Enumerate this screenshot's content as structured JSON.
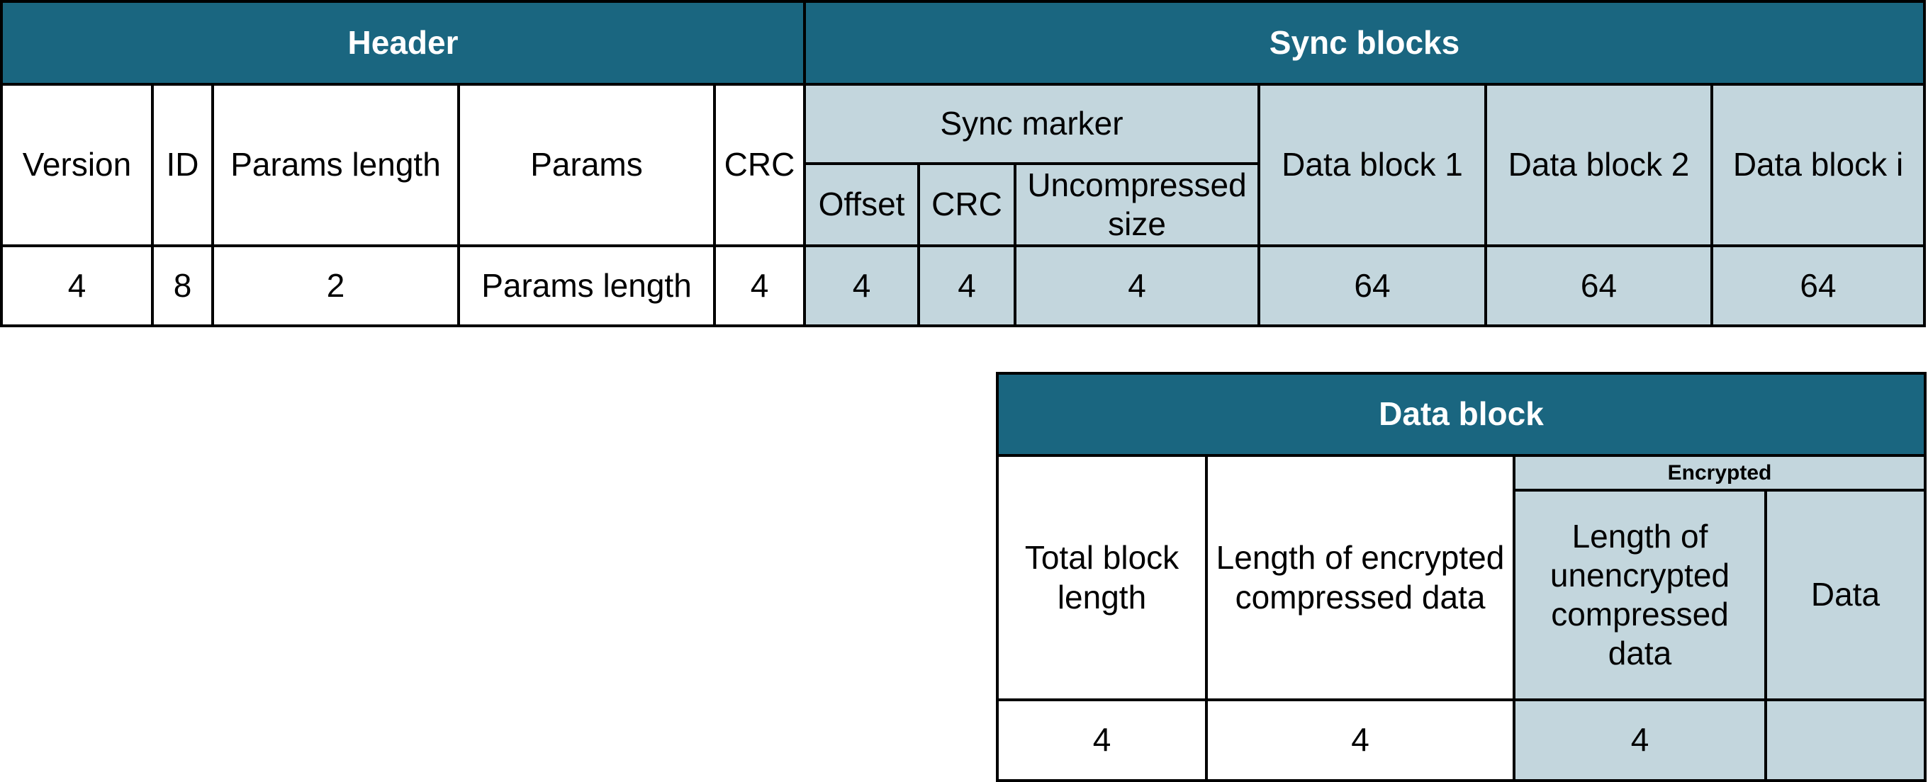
{
  "colors": {
    "band": "#1a6680",
    "light": "#c3d6dd",
    "white": "#ffffff"
  },
  "top_table": {
    "header_title": "Header",
    "sync_title": "Sync blocks",
    "sync_marker_label": "Sync marker",
    "header_fields": [
      {
        "label": "Version",
        "size": "4"
      },
      {
        "label": "ID",
        "size": "8"
      },
      {
        "label": "Params length",
        "size": "2"
      },
      {
        "label": "Params",
        "size": "Params length"
      },
      {
        "label": "CRC",
        "size": "4"
      }
    ],
    "sync_marker_fields": [
      {
        "label": "Offset",
        "size": "4"
      },
      {
        "label": "CRC",
        "size": "4"
      },
      {
        "label": "Uncompressed size",
        "size": "4"
      }
    ],
    "data_blocks": [
      {
        "label": "Data block 1",
        "size": "64"
      },
      {
        "label": "Data block 2",
        "size": "64"
      },
      {
        "label": "Data block i",
        "size": "64"
      }
    ]
  },
  "bottom_table": {
    "title": "Data block",
    "encrypted_label": "Encrypted",
    "fields": [
      {
        "label": "Total block length",
        "size": "4"
      },
      {
        "label": "Length of encrypted compressed data",
        "size": "4"
      }
    ],
    "encrypted_fields": [
      {
        "label": "Length of unencrypted compressed data",
        "size": "4"
      },
      {
        "label": "Data",
        "size": ""
      }
    ]
  }
}
